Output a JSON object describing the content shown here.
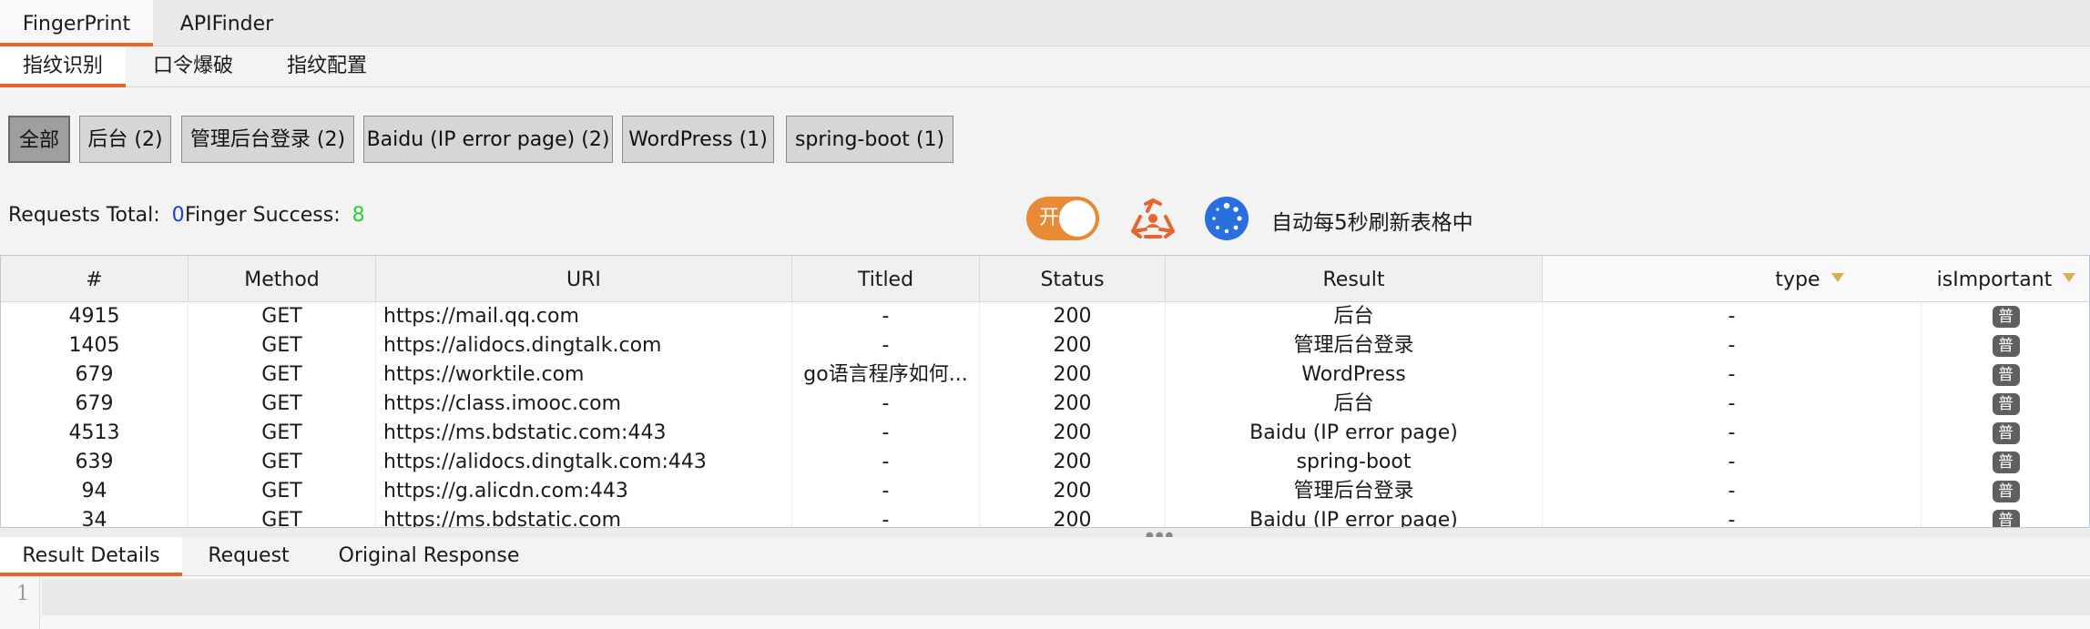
{
  "top_tabs": [
    {
      "label": "FingerPrint",
      "active": true
    },
    {
      "label": "APIFinder",
      "active": false
    }
  ],
  "sub_tabs": [
    {
      "label": "指纹识别",
      "active": true
    },
    {
      "label": "口令爆破",
      "active": false
    },
    {
      "label": "指纹配置",
      "active": false
    }
  ],
  "filters": [
    {
      "label": "全部",
      "selected": true
    },
    {
      "label": "后台 (2)",
      "selected": false
    },
    {
      "label": "管理后台登录 (2)",
      "selected": false
    },
    {
      "label": "Baidu (IP error page) (2)",
      "selected": false
    },
    {
      "label": "WordPress (1)",
      "selected": false
    },
    {
      "label": "spring-boot (1)",
      "selected": false
    }
  ],
  "stats": {
    "requests_label": "Requests Total:",
    "requests_value": "0",
    "success_label": "Finger Success:",
    "success_value": "8"
  },
  "controls": {
    "toggle_label": "开",
    "toggle_on": true,
    "refresh_icon": "recycle-refresh-icon",
    "loader_icon": "spinner-icon",
    "auto_refresh_text": "自动每5秒刷新表格中",
    "accent_color": "#e8642c",
    "toggle_color": "#e88a33",
    "spinner_color": "#2a6fe0"
  },
  "table": {
    "columns": [
      "#",
      "Method",
      "URI",
      "Titled",
      "Status",
      "Result",
      "type",
      "isImportant"
    ],
    "rows": [
      {
        "id": "4915",
        "method": "GET",
        "uri": "https://mail.qq.com",
        "titled": "-",
        "status": "200",
        "result": "后台",
        "type": "-",
        "important": "普"
      },
      {
        "id": "1405",
        "method": "GET",
        "uri": "https://alidocs.dingtalk.com",
        "titled": "-",
        "status": "200",
        "result": "管理后台登录",
        "type": "-",
        "important": "普"
      },
      {
        "id": "679",
        "method": "GET",
        "uri": "https://worktile.com",
        "titled": "go语言程序如何...",
        "status": "200",
        "result": "WordPress",
        "type": "-",
        "important": "普"
      },
      {
        "id": "679",
        "method": "GET",
        "uri": "https://class.imooc.com",
        "titled": "-",
        "status": "200",
        "result": "后台",
        "type": "-",
        "important": "普"
      },
      {
        "id": "4513",
        "method": "GET",
        "uri": "https://ms.bdstatic.com:443",
        "titled": "-",
        "status": "200",
        "result": "Baidu (IP error page)",
        "type": "-",
        "important": "普"
      },
      {
        "id": "639",
        "method": "GET",
        "uri": "https://alidocs.dingtalk.com:443",
        "titled": "-",
        "status": "200",
        "result": "spring-boot",
        "type": "-",
        "important": "普"
      },
      {
        "id": "94",
        "method": "GET",
        "uri": "https://g.alicdn.com:443",
        "titled": "-",
        "status": "200",
        "result": "管理后台登录",
        "type": "-",
        "important": "普"
      },
      {
        "id": "34",
        "method": "GET",
        "uri": "https://ms.bdstatic.com",
        "titled": "-",
        "status": "200",
        "result": "Baidu (IP error page)",
        "type": "-",
        "important": "普"
      }
    ]
  },
  "bottom_tabs": [
    {
      "label": "Result Details",
      "active": true
    },
    {
      "label": "Request",
      "active": false
    },
    {
      "label": "Original Response",
      "active": false
    }
  ],
  "editor": {
    "line_number": "1"
  }
}
